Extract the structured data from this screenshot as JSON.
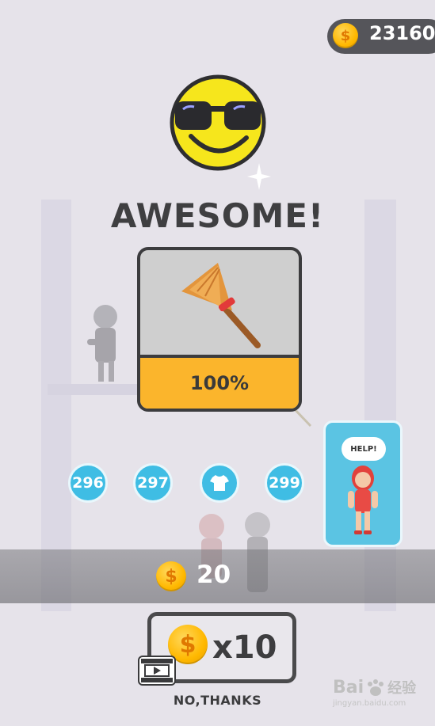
{
  "header": {
    "coin_total": "23160",
    "coin_icon": "dollar-coin-icon"
  },
  "result": {
    "title": "AWESOME!",
    "emoji": "cool-sunglasses-face-icon",
    "sparkle": "sparkle-icon"
  },
  "reward": {
    "item_icon": "broom-icon",
    "progress_label": "100%",
    "progress_fraction": 1.0
  },
  "levels": [
    {
      "label": "296",
      "type": "number"
    },
    {
      "label": "297",
      "type": "number"
    },
    {
      "label": "",
      "type": "shirt-icon"
    },
    {
      "label": "299",
      "type": "number"
    }
  ],
  "next_unlock": {
    "speech": "HELP!",
    "character": "red-haired-girl-icon"
  },
  "earnings": {
    "amount": "20"
  },
  "multiplier": {
    "label": "x10",
    "icon": "video-ad-icon"
  },
  "no_thanks": {
    "label": "NO,THANKS"
  },
  "watermark": {
    "brand": "Bai",
    "cn": "经验",
    "url": "jingyan.baidu.com"
  },
  "colors": {
    "accent_yellow": "#fbb52c",
    "level_blue": "#3fbde4",
    "help_blue": "#5bc4e3",
    "text_dark": "#3f3f41"
  }
}
